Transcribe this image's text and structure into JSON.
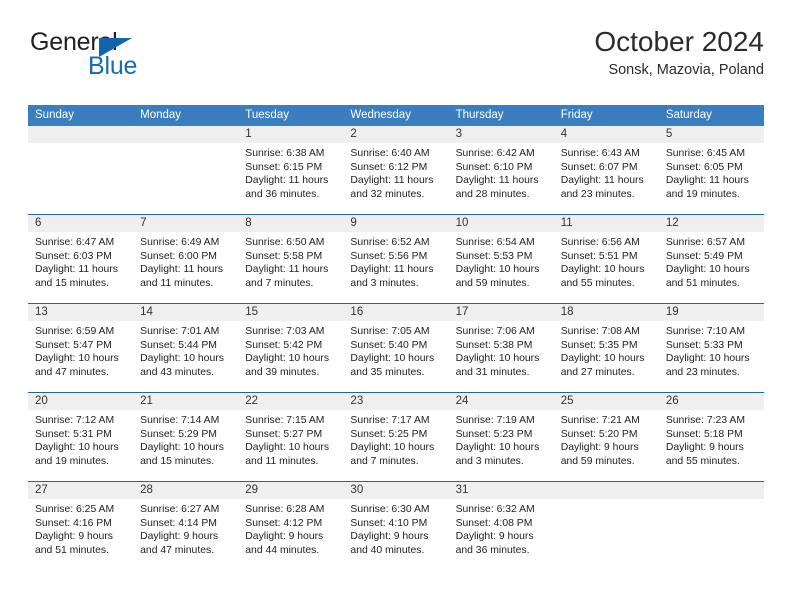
{
  "brand": {
    "word1": "General",
    "word2": "Blue",
    "triangle_color": "#1463ad",
    "blue_color": "#1769b3"
  },
  "header": {
    "title": "October 2024",
    "location": "Sonsk, Mazovia, Poland"
  },
  "theme": {
    "header_bar": "#3a7ebf",
    "row_rule": "#1f63a8",
    "daynum_band": "#efefef"
  },
  "weekdays": [
    "Sunday",
    "Monday",
    "Tuesday",
    "Wednesday",
    "Thursday",
    "Friday",
    "Saturday"
  ],
  "labels": {
    "sunrise_prefix": "Sunrise: ",
    "sunset_prefix": "Sunset: ",
    "daylight_prefix": "Daylight: "
  },
  "weeks": [
    [
      {
        "day": "",
        "blank": true
      },
      {
        "day": "",
        "blank": true
      },
      {
        "day": "1",
        "sunrise": "Sunrise: 6:38 AM",
        "sunset": "Sunset: 6:15 PM",
        "daylight": "Daylight: 11 hours and 36 minutes."
      },
      {
        "day": "2",
        "sunrise": "Sunrise: 6:40 AM",
        "sunset": "Sunset: 6:12 PM",
        "daylight": "Daylight: 11 hours and 32 minutes."
      },
      {
        "day": "3",
        "sunrise": "Sunrise: 6:42 AM",
        "sunset": "Sunset: 6:10 PM",
        "daylight": "Daylight: 11 hours and 28 minutes."
      },
      {
        "day": "4",
        "sunrise": "Sunrise: 6:43 AM",
        "sunset": "Sunset: 6:07 PM",
        "daylight": "Daylight: 11 hours and 23 minutes."
      },
      {
        "day": "5",
        "sunrise": "Sunrise: 6:45 AM",
        "sunset": "Sunset: 6:05 PM",
        "daylight": "Daylight: 11 hours and 19 minutes."
      }
    ],
    [
      {
        "day": "6",
        "sunrise": "Sunrise: 6:47 AM",
        "sunset": "Sunset: 6:03 PM",
        "daylight": "Daylight: 11 hours and 15 minutes."
      },
      {
        "day": "7",
        "sunrise": "Sunrise: 6:49 AM",
        "sunset": "Sunset: 6:00 PM",
        "daylight": "Daylight: 11 hours and 11 minutes."
      },
      {
        "day": "8",
        "sunrise": "Sunrise: 6:50 AM",
        "sunset": "Sunset: 5:58 PM",
        "daylight": "Daylight: 11 hours and 7 minutes."
      },
      {
        "day": "9",
        "sunrise": "Sunrise: 6:52 AM",
        "sunset": "Sunset: 5:56 PM",
        "daylight": "Daylight: 11 hours and 3 minutes."
      },
      {
        "day": "10",
        "sunrise": "Sunrise: 6:54 AM",
        "sunset": "Sunset: 5:53 PM",
        "daylight": "Daylight: 10 hours and 59 minutes."
      },
      {
        "day": "11",
        "sunrise": "Sunrise: 6:56 AM",
        "sunset": "Sunset: 5:51 PM",
        "daylight": "Daylight: 10 hours and 55 minutes."
      },
      {
        "day": "12",
        "sunrise": "Sunrise: 6:57 AM",
        "sunset": "Sunset: 5:49 PM",
        "daylight": "Daylight: 10 hours and 51 minutes."
      }
    ],
    [
      {
        "day": "13",
        "sunrise": "Sunrise: 6:59 AM",
        "sunset": "Sunset: 5:47 PM",
        "daylight": "Daylight: 10 hours and 47 minutes."
      },
      {
        "day": "14",
        "sunrise": "Sunrise: 7:01 AM",
        "sunset": "Sunset: 5:44 PM",
        "daylight": "Daylight: 10 hours and 43 minutes."
      },
      {
        "day": "15",
        "sunrise": "Sunrise: 7:03 AM",
        "sunset": "Sunset: 5:42 PM",
        "daylight": "Daylight: 10 hours and 39 minutes."
      },
      {
        "day": "16",
        "sunrise": "Sunrise: 7:05 AM",
        "sunset": "Sunset: 5:40 PM",
        "daylight": "Daylight: 10 hours and 35 minutes."
      },
      {
        "day": "17",
        "sunrise": "Sunrise: 7:06 AM",
        "sunset": "Sunset: 5:38 PM",
        "daylight": "Daylight: 10 hours and 31 minutes."
      },
      {
        "day": "18",
        "sunrise": "Sunrise: 7:08 AM",
        "sunset": "Sunset: 5:35 PM",
        "daylight": "Daylight: 10 hours and 27 minutes."
      },
      {
        "day": "19",
        "sunrise": "Sunrise: 7:10 AM",
        "sunset": "Sunset: 5:33 PM",
        "daylight": "Daylight: 10 hours and 23 minutes."
      }
    ],
    [
      {
        "day": "20",
        "sunrise": "Sunrise: 7:12 AM",
        "sunset": "Sunset: 5:31 PM",
        "daylight": "Daylight: 10 hours and 19 minutes."
      },
      {
        "day": "21",
        "sunrise": "Sunrise: 7:14 AM",
        "sunset": "Sunset: 5:29 PM",
        "daylight": "Daylight: 10 hours and 15 minutes."
      },
      {
        "day": "22",
        "sunrise": "Sunrise: 7:15 AM",
        "sunset": "Sunset: 5:27 PM",
        "daylight": "Daylight: 10 hours and 11 minutes."
      },
      {
        "day": "23",
        "sunrise": "Sunrise: 7:17 AM",
        "sunset": "Sunset: 5:25 PM",
        "daylight": "Daylight: 10 hours and 7 minutes."
      },
      {
        "day": "24",
        "sunrise": "Sunrise: 7:19 AM",
        "sunset": "Sunset: 5:23 PM",
        "daylight": "Daylight: 10 hours and 3 minutes."
      },
      {
        "day": "25",
        "sunrise": "Sunrise: 7:21 AM",
        "sunset": "Sunset: 5:20 PM",
        "daylight": "Daylight: 9 hours and 59 minutes."
      },
      {
        "day": "26",
        "sunrise": "Sunrise: 7:23 AM",
        "sunset": "Sunset: 5:18 PM",
        "daylight": "Daylight: 9 hours and 55 minutes."
      }
    ],
    [
      {
        "day": "27",
        "sunrise": "Sunrise: 6:25 AM",
        "sunset": "Sunset: 4:16 PM",
        "daylight": "Daylight: 9 hours and 51 minutes."
      },
      {
        "day": "28",
        "sunrise": "Sunrise: 6:27 AM",
        "sunset": "Sunset: 4:14 PM",
        "daylight": "Daylight: 9 hours and 47 minutes."
      },
      {
        "day": "29",
        "sunrise": "Sunrise: 6:28 AM",
        "sunset": "Sunset: 4:12 PM",
        "daylight": "Daylight: 9 hours and 44 minutes."
      },
      {
        "day": "30",
        "sunrise": "Sunrise: 6:30 AM",
        "sunset": "Sunset: 4:10 PM",
        "daylight": "Daylight: 9 hours and 40 minutes."
      },
      {
        "day": "31",
        "sunrise": "Sunrise: 6:32 AM",
        "sunset": "Sunset: 4:08 PM",
        "daylight": "Daylight: 9 hours and 36 minutes."
      },
      {
        "day": "",
        "blank": true
      },
      {
        "day": "",
        "blank": true
      }
    ]
  ]
}
